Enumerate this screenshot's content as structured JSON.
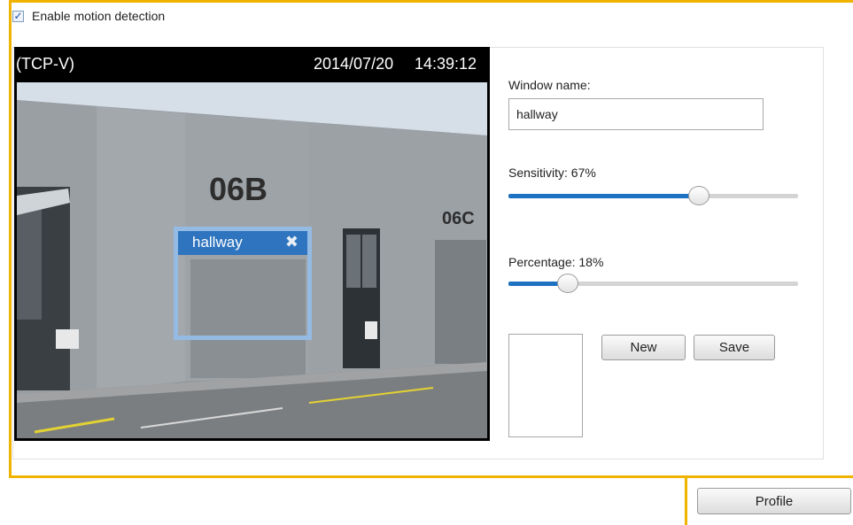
{
  "motion": {
    "enable_label": "Enable motion detection",
    "enabled": true
  },
  "video": {
    "source": "(TCP-V)",
    "date": "2014/07/20",
    "time": "14:39:12",
    "window_title": "hallway",
    "building_sign_left": "06B",
    "building_sign_right": "06C"
  },
  "settings": {
    "window_name_label": "Window name:",
    "window_name_value": "hallway",
    "sensitivity_label": "Sensitivity: 67%",
    "sensitivity_value": 67,
    "percentage_label": "Percentage: 18%",
    "percentage_value": 18,
    "new_button": "New",
    "save_button": "Save"
  },
  "footer": {
    "profile_button": "Profile"
  },
  "colors": {
    "accent_orange": "#f0b400",
    "slider_blue": "#1f72c2",
    "window_title_blue": "#2e74be",
    "window_border_blue": "#94bbe3"
  }
}
